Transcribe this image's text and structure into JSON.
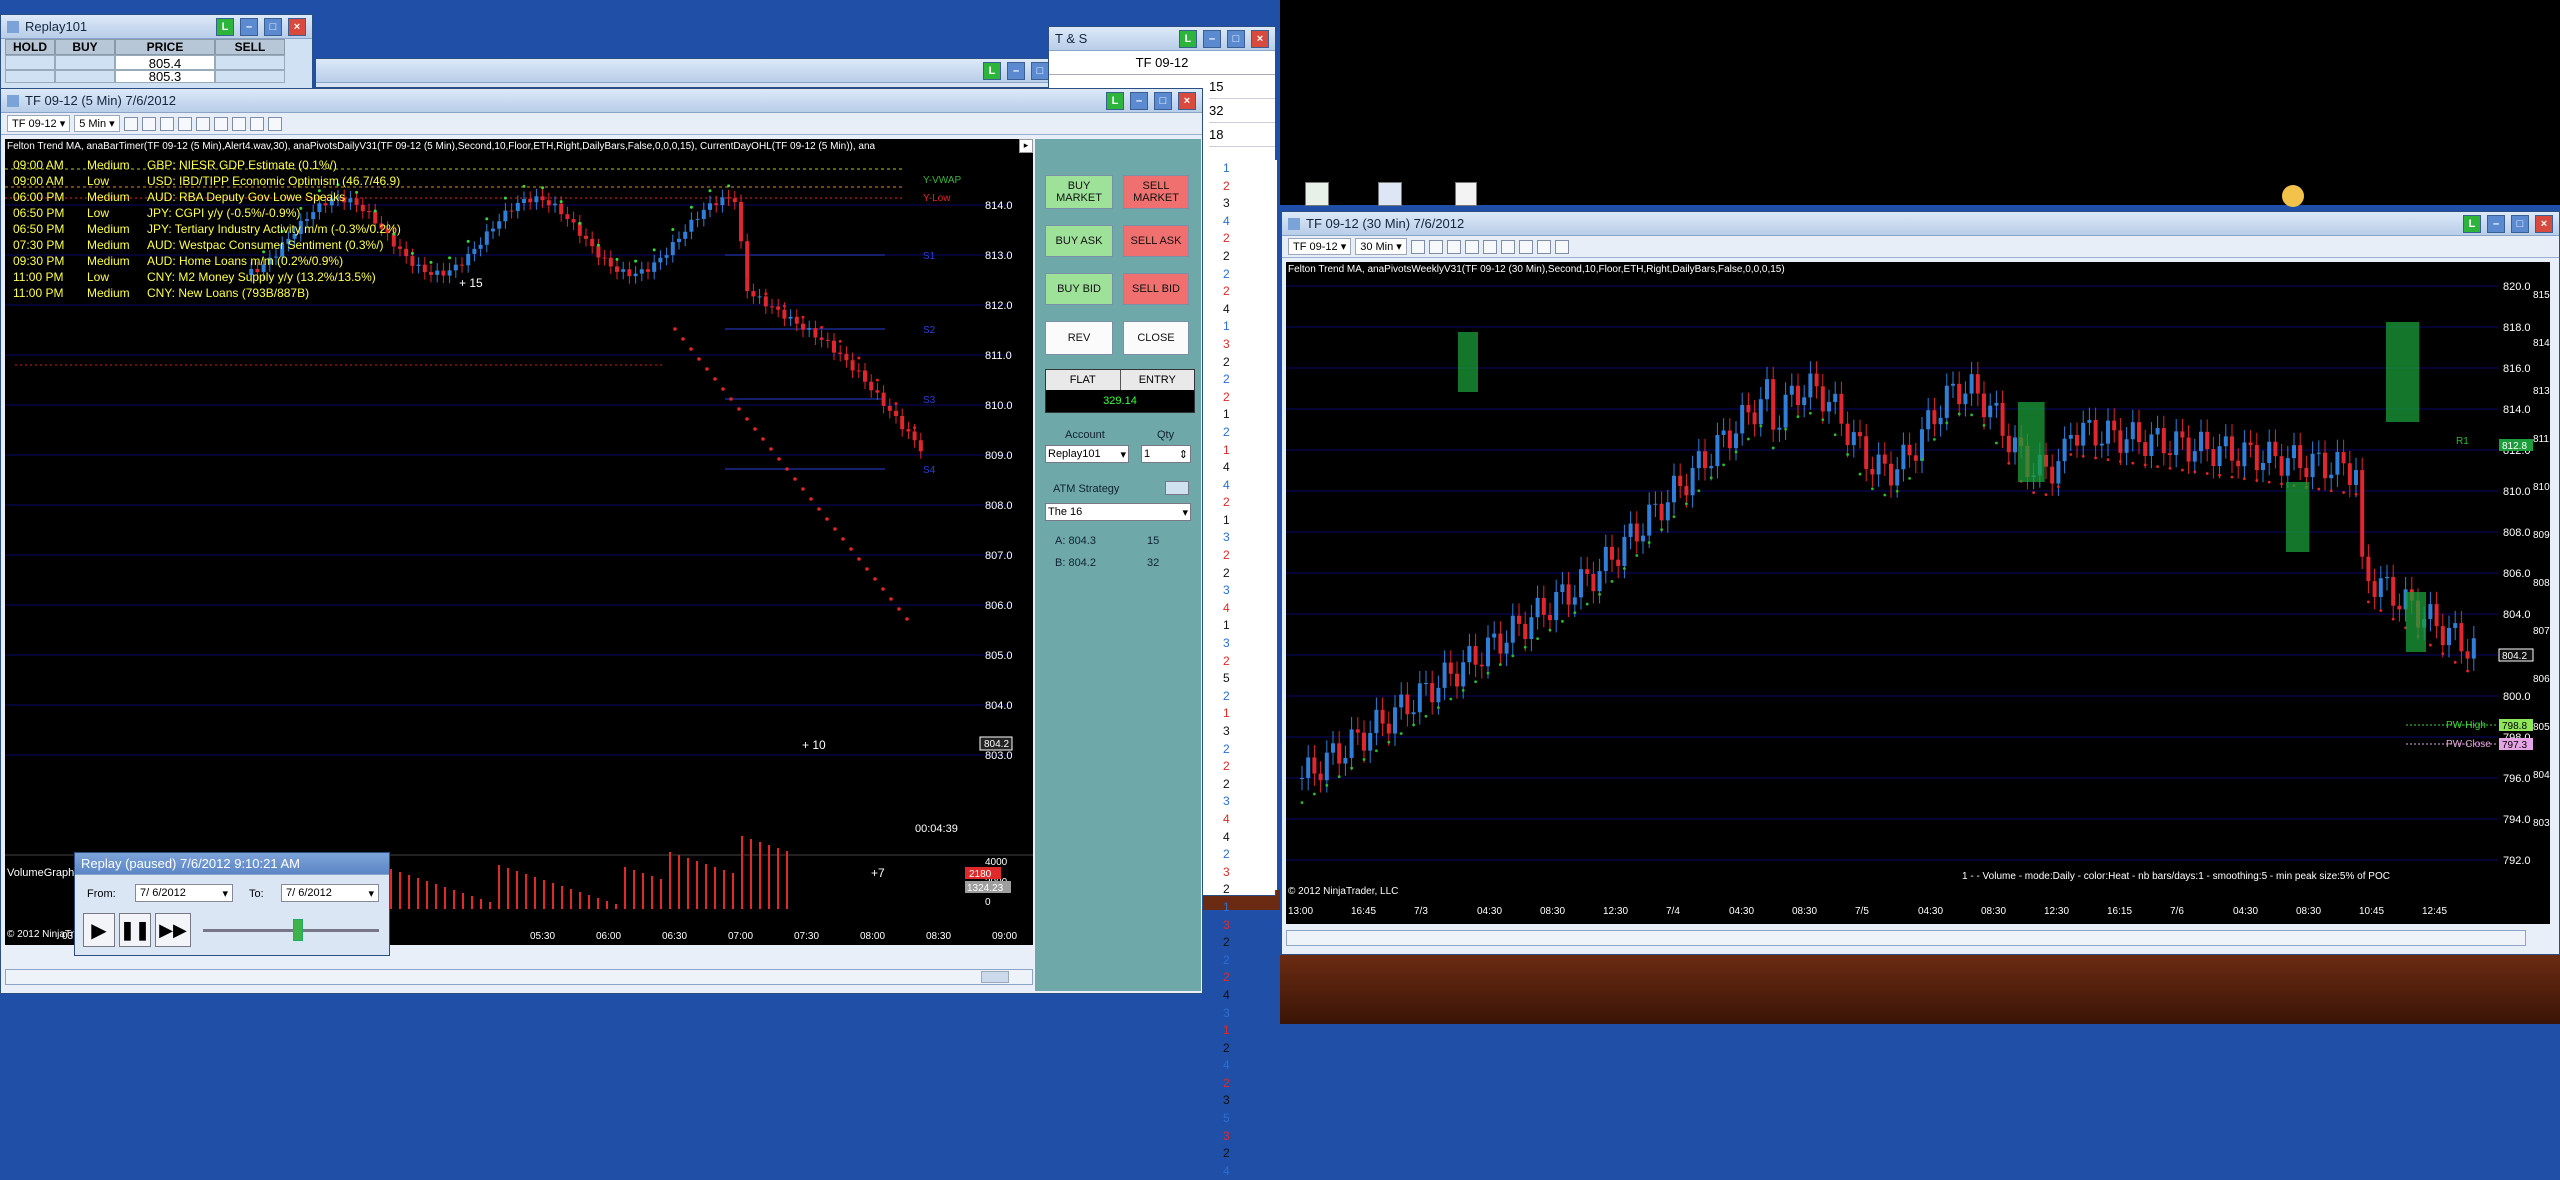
{
  "replay_win": {
    "title": "Replay101",
    "headers": [
      "HOLD",
      "BUY",
      "PRICE",
      "SELL"
    ],
    "rows": [
      [
        "",
        "",
        "805.4",
        ""
      ],
      [
        "",
        "",
        "805.3",
        ""
      ]
    ]
  },
  "ts_win": {
    "title": "T & S",
    "instrument": "TF 09-12",
    "rows": [
      "15",
      "32",
      "18"
    ]
  },
  "main_chart": {
    "title": "TF 09-12 (5 Min)  7/6/2012",
    "instrument": "TF 09-12",
    "interval": "5 Min",
    "indicator_line": "Felton Trend MA, anaBarTimer(TF 09-12 (5 Min),Alert4.wav,30), anaPivotsDailyV31(TF 09-12 (5 Min),Second,10,Floor,ETH,Right,DailyBars,False,0,0,0,15), CurrentDayOHL(TF 09-12 (5 Min)), ana",
    "news": [
      {
        "time": "09:00 AM",
        "level": "Medium",
        "text": "GBP: NIESR GDP Estimate (0.1%/)"
      },
      {
        "time": "09:00 AM",
        "level": "Low",
        "text": "USD: IBD/TIPP Economic Optimism (46.7/46.9)"
      },
      {
        "time": "06:00 PM",
        "level": "Medium",
        "text": "AUD: RBA Deputy Gov Lowe Speaks"
      },
      {
        "time": "06:50 PM",
        "level": "Low",
        "text": "JPY: CGPI y/y (-0.5%/-0.9%)"
      },
      {
        "time": "06:50 PM",
        "level": "Medium",
        "text": "JPY: Tertiary Industry Activity m/m (-0.3%/0.2%)"
      },
      {
        "time": "07:30 PM",
        "level": "Medium",
        "text": "AUD: Westpac Consumer Sentiment (0.3%/)"
      },
      {
        "time": "09:30 PM",
        "level": "Medium",
        "text": "AUD: Home Loans m/m (0.2%/0.9%)"
      },
      {
        "time": "11:00 PM",
        "level": "Low",
        "text": "CNY: M2 Money Supply y/y (13.2%/13.5%)"
      },
      {
        "time": "11:00 PM",
        "level": "Medium",
        "text": "CNY: New Loans (793B/887B)"
      }
    ],
    "price_labels": [
      "814.0",
      "813.0",
      "812.0",
      "811.0",
      "810.0",
      "809.0",
      "808.0",
      "807.0",
      "806.0",
      "805.0",
      "804.0",
      "803.0"
    ],
    "current_price": "804.2",
    "level_labels": {
      "vwap": "Y-VWAP",
      "ylow": "Y-Low",
      "s1": "S1",
      "s2": "S2",
      "s3": "S3",
      "s4": "S4"
    },
    "annotations": [
      "+ 15",
      "+ 10",
      "+7"
    ],
    "timer": "00:04:39",
    "volume_title": "VolumeGraph",
    "volume_labels": [
      "4000",
      "2000",
      "0"
    ],
    "volume_badges": [
      "2180",
      "1324.23"
    ],
    "x_labels": [
      "03:00",
      "05:30",
      "06:00",
      "06:30",
      "07:00",
      "07:30",
      "08:00",
      "08:30",
      "09:00"
    ],
    "copyright": "© 2012 NinjaTrader, LLC"
  },
  "order_panel": {
    "buttons": {
      "buy_market": "BUY MARKET",
      "sell_market": "SELL MARKET",
      "buy_ask": "BUY ASK",
      "sell_ask": "SELL ASK",
      "buy_bid": "BUY BID",
      "sell_bid": "SELL BID",
      "rev": "REV",
      "close": "CLOSE"
    },
    "flat": "FLAT",
    "entry": "ENTRY",
    "pnl": "329.14",
    "account_label": "Account",
    "qty_label": "Qty",
    "account": "Replay101",
    "qty": "1",
    "atm_label": "ATM Strategy",
    "atm_value": "The 16",
    "ask": "A: 804.3",
    "ask_qty": "15",
    "bid": "B: 804.2",
    "bid_qty": "32"
  },
  "ts_column": [
    "1",
    "2",
    "3",
    "4",
    "2",
    "2",
    "2",
    "2",
    "4",
    "1",
    "3",
    "2",
    "2",
    "2",
    "1",
    "2",
    "1",
    "4",
    "4",
    "2",
    "1",
    "3",
    "2",
    "2",
    "3",
    "4",
    "1",
    "3",
    "2",
    "5",
    "2",
    "1",
    "3",
    "2",
    "2",
    "2",
    "3",
    "4",
    "4",
    "2",
    "3",
    "2",
    "1",
    "3",
    "2",
    "2",
    "2",
    "4",
    "3",
    "1",
    "2",
    "4",
    "2",
    "3",
    "5",
    "3",
    "2",
    "4"
  ],
  "replay_ctl": {
    "title": "Replay (paused) 7/6/2012 9:10:21 AM",
    "from_label": "From:",
    "from": "7/ 6/2012",
    "to_label": "To:",
    "to": "7/ 6/2012"
  },
  "weekly_chart": {
    "title": "TF 09-12 (30 Min)  7/6/2012",
    "instrument": "TF 09-12",
    "interval": "30 Min",
    "indicator_line": "Felton Trend MA, anaPivotsWeeklyV31(TF 09-12 (30 Min),Second,10,Floor,ETH,Right,DailyBars,False,0,0,0,15)",
    "price_labels": [
      "820.0",
      "818.0",
      "816.0",
      "814.0",
      "812.0",
      "810.0",
      "808.0",
      "806.0",
      "804.0",
      "802.0",
      "800.0",
      "798.0",
      "796.0",
      "794.0",
      "792.0"
    ],
    "right_labels": [
      "815.0",
      "814.0",
      "813.0",
      "811.0",
      "810.0",
      "809.0",
      "808.0",
      "807.0",
      "806.0",
      "805.0",
      "804.0",
      "803.0"
    ],
    "badges": {
      "price": "812.8",
      "current": "804.2",
      "pw_high": "798.8",
      "pw_close": "797.3"
    },
    "r1": "R1",
    "pw_high": "PW-High",
    "pw_close": "PW-Close",
    "volume_note": "1 -  - Volume - mode:Daily - color:Heat - nb bars/days:1 - smoothing:5 - min peak size:5% of POC",
    "x_labels": [
      "13:00",
      "16:45",
      "7/3",
      "04:30",
      "08:30",
      "12:30",
      "7/4",
      "04:30",
      "08:30",
      "7/5",
      "04:30",
      "08:30",
      "12:30",
      "16:15",
      "7/6",
      "04:30",
      "08:30",
      "10:45",
      "12:45"
    ],
    "copyright": "© 2012 NinjaTrader, LLC"
  },
  "colors": {
    "desktop": "#1f4fa6",
    "bull": "#2f7fd8",
    "bear": "#e0262e",
    "news_yellow": "#ffff4d",
    "trend_red": "#e12626",
    "trend_green": "#2dbb2d"
  }
}
